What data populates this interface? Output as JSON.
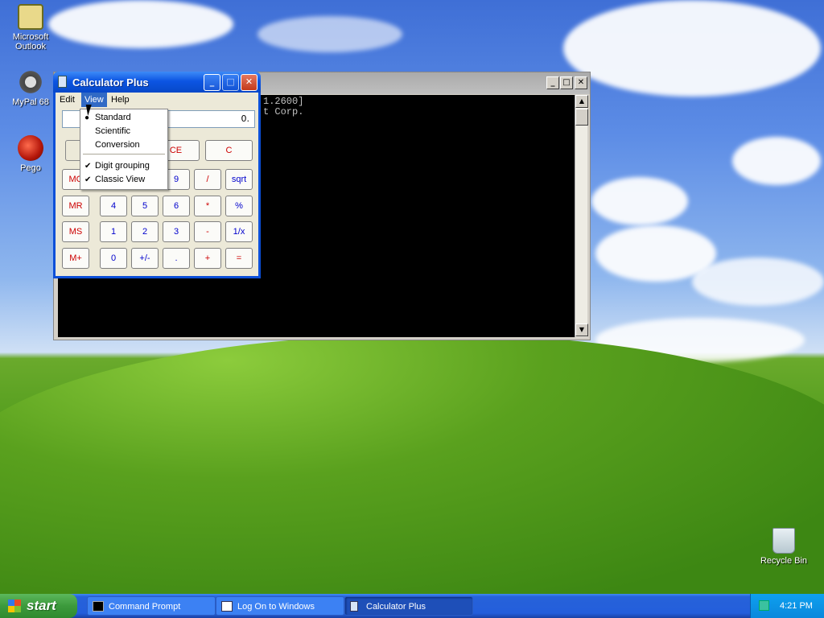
{
  "desktop": {
    "icons": [
      {
        "label": "Microsoft Outlook",
        "icon": "outlook-icon"
      },
      {
        "label": "MyPal 68",
        "icon": "raccoon-icon"
      },
      {
        "label": "Pego",
        "icon": "red-ball-icon"
      },
      {
        "label": "Recycle Bin",
        "icon": "recycle-bin-icon"
      }
    ]
  },
  "cmd_window": {
    "title": "Command Prompt",
    "console_lines": [
      "1.2600]",
      "t Corp."
    ]
  },
  "calculator": {
    "title": "Calculator Plus",
    "menu": {
      "edit": "Edit",
      "view": "View",
      "help": "Help"
    },
    "display": "0.",
    "keys": {
      "ce": "CE",
      "c": "C",
      "mc": "MC",
      "mr": "MR",
      "ms": "MS",
      "mplus": "M+",
      "k9": "9",
      "div": "/",
      "sqrt": "sqrt",
      "k4": "4",
      "k5": "5",
      "k6": "6",
      "mul": "*",
      "pct": "%",
      "k1": "1",
      "k2": "2",
      "k3": "3",
      "sub": "-",
      "inv": "1/x",
      "k0": "0",
      "sign": "+/-",
      "dot": ".",
      "add": "+",
      "eq": "="
    }
  },
  "view_menu": {
    "items": [
      {
        "label": "Standard",
        "checked": true
      },
      {
        "label": "Scientific",
        "checked": false
      },
      {
        "label": "Conversion",
        "checked": false
      },
      {
        "label": "Digit grouping",
        "checked": true
      },
      {
        "label": "Classic View",
        "checked": true
      }
    ]
  },
  "taskbar": {
    "start_label": "start",
    "buttons": [
      {
        "label": "Command Prompt",
        "active": false
      },
      {
        "label": "Log On to Windows",
        "active": false
      },
      {
        "label": "Calculator Plus",
        "active": true
      }
    ],
    "clock": "4:21 PM"
  },
  "colors": {
    "taskbar": "#245edb",
    "titlebar_active": "#0c55e3",
    "start_button": "#3c9a3c",
    "menu_highlight": "#316ac5"
  }
}
